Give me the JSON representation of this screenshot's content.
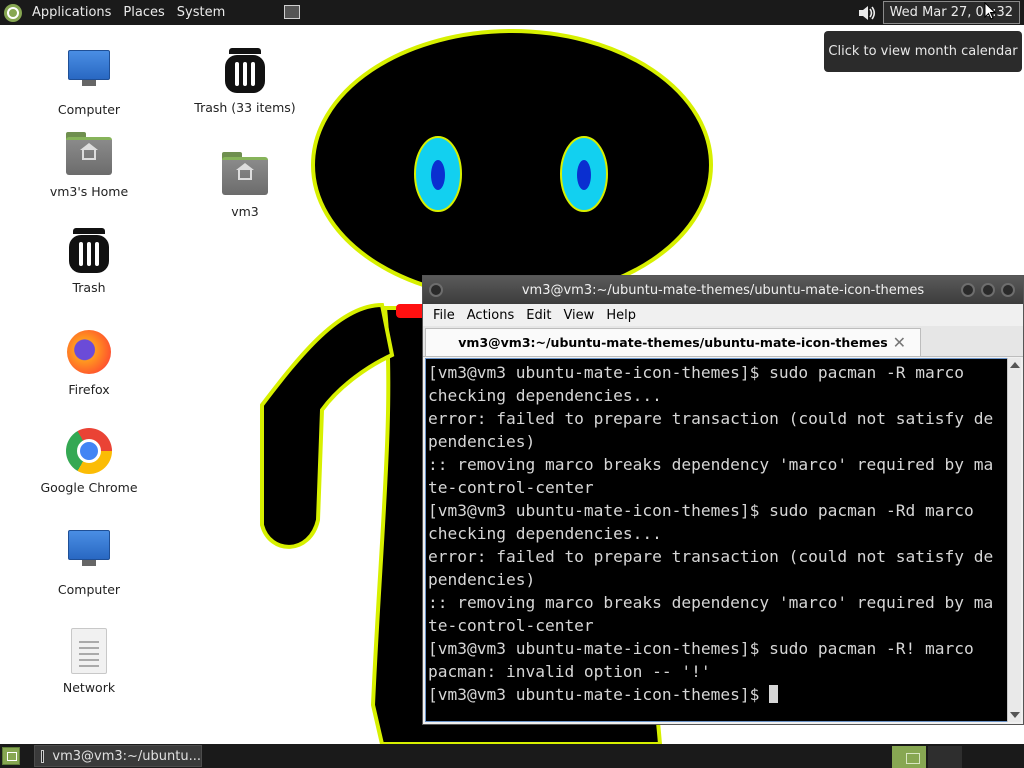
{
  "top_panel": {
    "menus": [
      "Applications",
      "Places",
      "System"
    ],
    "clock": "Wed Mar 27, 02:32",
    "tooltip": "Click to view month calendar",
    "icons": [
      "mate-logo-icon",
      "show-desktop-icon",
      "volume-icon"
    ]
  },
  "desktop": {
    "icons": [
      {
        "label": "Computer",
        "icon": "computer-icon"
      },
      {
        "label": "vm3's Home",
        "icon": "home-folder-icon"
      },
      {
        "label": "Trash",
        "icon": "trash-icon"
      },
      {
        "label": "Firefox",
        "icon": "firefox-icon"
      },
      {
        "label": "Google Chrome",
        "icon": "chrome-icon"
      },
      {
        "label": "Computer",
        "icon": "computer-icon"
      },
      {
        "label": "Network",
        "icon": "network-icon"
      },
      {
        "label": "Trash (33 items)",
        "icon": "trash-icon"
      },
      {
        "label": "vm3",
        "icon": "home-folder-icon"
      }
    ]
  },
  "terminal": {
    "window_title": "vm3@vm3:~/ubuntu-mate-themes/ubuntu-mate-icon-themes",
    "menu": [
      "File",
      "Actions",
      "Edit",
      "View",
      "Help"
    ],
    "tab_title": "vm3@vm3:~/ubuntu-mate-themes/ubuntu-mate-icon-themes",
    "lines": [
      "[vm3@vm3 ubuntu-mate-icon-themes]$ sudo pacman -R marco",
      "checking dependencies...",
      "error: failed to prepare transaction (could not satisfy de",
      "pendencies)",
      ":: removing marco breaks dependency 'marco' required by ma",
      "te-control-center",
      "[vm3@vm3 ubuntu-mate-icon-themes]$ sudo pacman -Rd marco",
      "checking dependencies...",
      "error: failed to prepare transaction (could not satisfy de",
      "pendencies)",
      ":: removing marco breaks dependency 'marco' required by ma",
      "te-control-center",
      "[vm3@vm3 ubuntu-mate-icon-themes]$ sudo pacman -R! marco",
      "pacman: invalid option -- '!'"
    ],
    "prompt": "[vm3@vm3 ubuntu-mate-icon-themes]$ "
  },
  "bottom_panel": {
    "task_label": "vm3@vm3:~/ubuntu..."
  },
  "colors": {
    "panel": "#1a1a1a",
    "accent": "#87a752",
    "terminal_bg": "#000000",
    "terminal_fg": "#d6d6d6",
    "wallpaper_figure": "#000000",
    "wallpaper_outline": "#d7f000",
    "wallpaper_eye": "#12d0f0",
    "wallpaper_pupil": "#0a2fd0",
    "wallpaper_scarf": "#ff1010"
  }
}
